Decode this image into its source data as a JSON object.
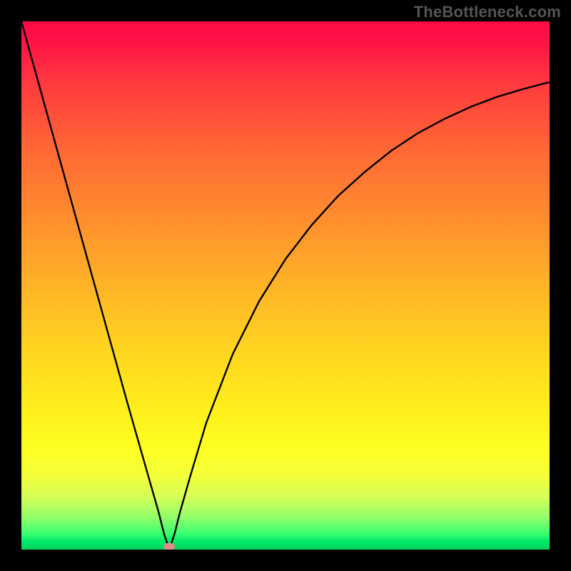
{
  "watermark": "TheBottleneck.com",
  "chart_data": {
    "type": "line",
    "title": "",
    "xlabel": "",
    "ylabel": "",
    "xlim": [
      0,
      100
    ],
    "ylim": [
      0,
      100
    ],
    "grid": false,
    "legend": false,
    "background_gradient": {
      "direction": "top-to-bottom",
      "stops": [
        {
          "value": 100,
          "color": "#ff0846"
        },
        {
          "value": 50,
          "color": "#ffb327"
        },
        {
          "value": 20,
          "color": "#fdff22"
        },
        {
          "value": 5,
          "color": "#8fff6a"
        },
        {
          "value": 0,
          "color": "#00d45e"
        }
      ]
    },
    "series": [
      {
        "name": "curve",
        "x": [
          0,
          5,
          10,
          15,
          20,
          24,
          26,
          27,
          27.8,
          28,
          28.2,
          29,
          30,
          32,
          35,
          40,
          45,
          50,
          55,
          60,
          65,
          70,
          75,
          80,
          85,
          90,
          95,
          100
        ],
        "y": [
          100,
          82,
          64,
          46,
          28,
          14,
          7,
          3,
          0.6,
          0,
          0.6,
          3,
          7,
          14,
          24,
          37,
          47,
          55,
          61.5,
          67,
          71.5,
          75.5,
          78.8,
          81.5,
          83.8,
          85.7,
          87.2,
          88.5
        ],
        "color": "#000000",
        "stroke_width": 2.4
      }
    ],
    "marker": {
      "x": 28,
      "y": 0.5,
      "color": "#e58b8b",
      "shape": "ellipse"
    }
  }
}
